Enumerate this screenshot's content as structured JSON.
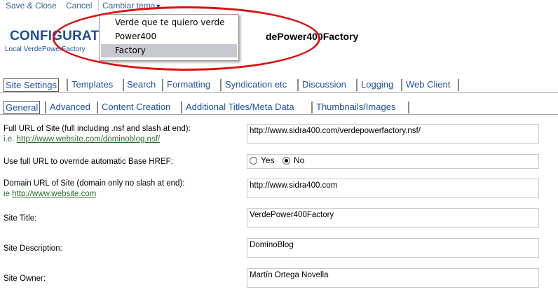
{
  "toolbar": {
    "save_close": "Save & Close",
    "cancel": "Cancel",
    "theme_menu": "Cambiar tema"
  },
  "theme_dropdown": {
    "items": [
      "Verde que te quiero verde",
      "Power400",
      "Factory"
    ],
    "selected": "Factory"
  },
  "header": {
    "title_visible": "CONFIGURAT",
    "title_right": "dePower400Factory",
    "subtitle": "Local VerdePowerFactory"
  },
  "tabs_primary": [
    "Site Settings",
    "Templates",
    "Search",
    "Formatting",
    "Syndication etc",
    "Discussion",
    "Logging",
    "Web Client"
  ],
  "tabs_secondary": [
    "General",
    "Advanced",
    "Content Creation",
    "Additional Titles/Meta Data",
    "Thumbnails/Images"
  ],
  "form": {
    "full_url": {
      "label": "Full URL of Site (full including .nsf and slash at end):",
      "hint_prefix": "i.e. ",
      "hint_link": "http://www.website.com/dominoblog.nsf/",
      "value": "http://www.sidra400.com/verdepowerfactory.nsf/"
    },
    "use_full_url": {
      "label": "Use full URL to override automatic Base HREF:",
      "yes": "Yes",
      "no": "No",
      "selected": "No"
    },
    "domain_url": {
      "label": "Domain URL of Site (domain only no slash at end):",
      "hint_prefix": "ie ",
      "hint_link": "http://www.website.com",
      "value": "http://www.sidra400.com"
    },
    "site_title": {
      "label": "Site Title:",
      "value": "VerdePower400Factory"
    },
    "site_description": {
      "label": "Site Description:",
      "value": "DominoBlog"
    },
    "site_owner": {
      "label": "Site Owner:",
      "value": "Martín Ortega Novella"
    }
  },
  "colors": {
    "link": "#336699",
    "title": "#1c4f9c",
    "hint": "#2a6d2a",
    "highlight_ellipse": "#dd1111",
    "dropdown_selected": "#c8c8d0"
  }
}
